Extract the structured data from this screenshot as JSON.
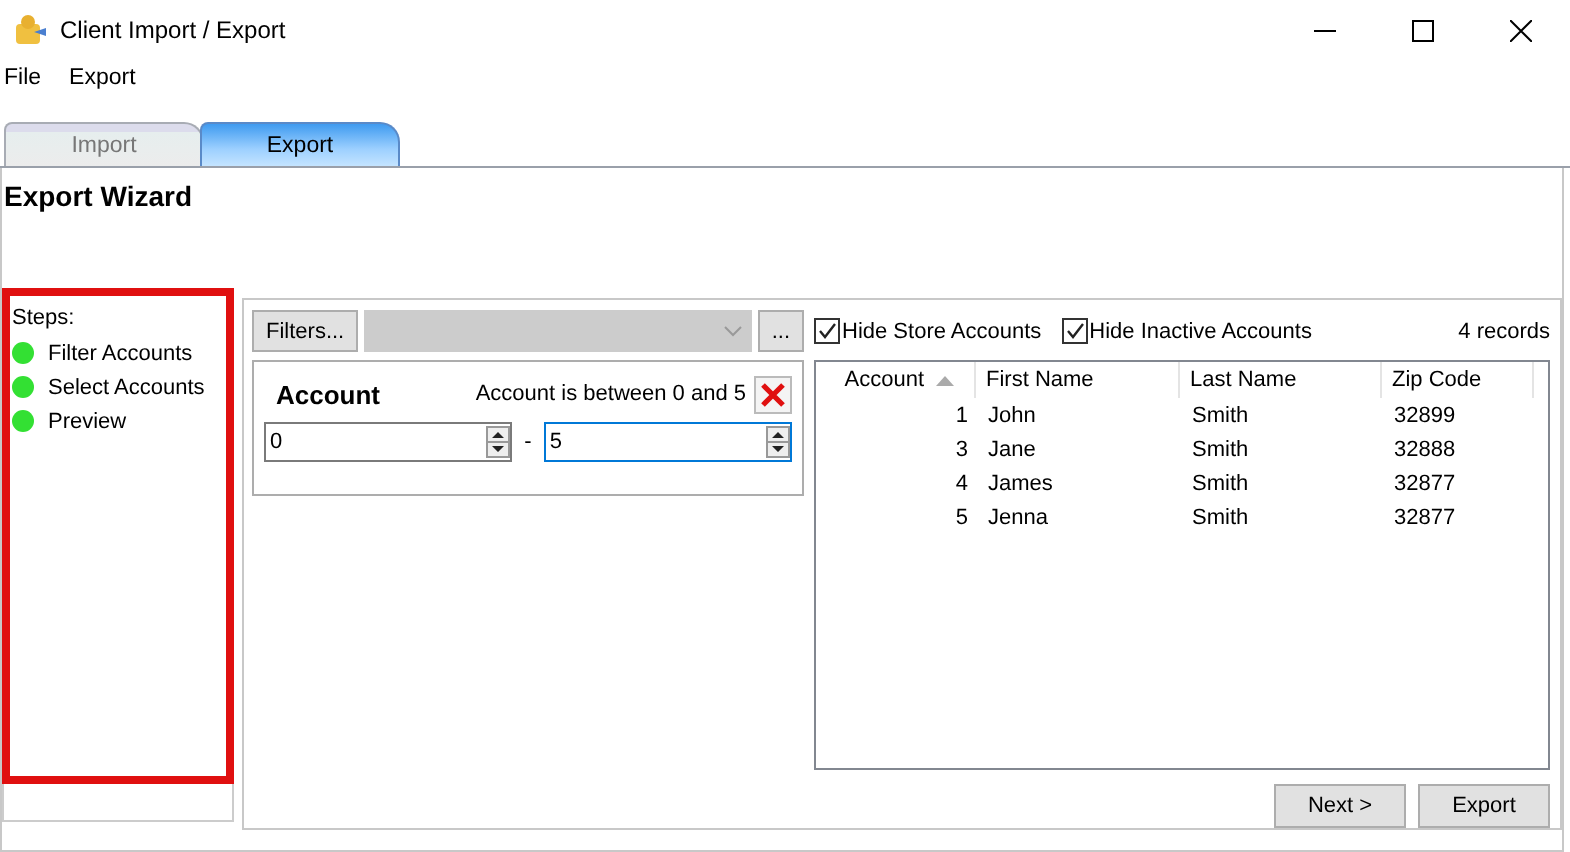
{
  "window": {
    "title": "Client Import / Export"
  },
  "menu": [
    "File",
    "Export"
  ],
  "tabs": [
    {
      "label": "Import",
      "selected": false
    },
    {
      "label": "Export",
      "selected": true
    }
  ],
  "wizard": {
    "title": "Export Wizard"
  },
  "steps": {
    "heading": "Steps:",
    "highlighted": true,
    "items": [
      {
        "label": "Filter Accounts",
        "color": "#33e033"
      },
      {
        "label": "Select Accounts",
        "color": "#33e033"
      },
      {
        "label": "Preview",
        "color": "#33e033"
      }
    ]
  },
  "filters": {
    "button": "Filters...",
    "combo_disabled": true,
    "more_button": "...",
    "card": {
      "field": "Account",
      "description": "Account is between 0 and 5",
      "separator": "-",
      "from": {
        "value": "0",
        "focused": false
      },
      "to": {
        "value": "5",
        "focused": true
      }
    }
  },
  "options": [
    {
      "label": "Hide Store Accounts",
      "checked": true
    },
    {
      "label": "Hide Inactive Accounts",
      "checked": true
    }
  ],
  "record_count": "4 records",
  "table": {
    "columns": [
      {
        "label": "Account",
        "sorted": true
      },
      {
        "label": "First Name",
        "sorted": false
      },
      {
        "label": "Last Name",
        "sorted": false
      },
      {
        "label": "Zip Code",
        "sorted": false
      }
    ],
    "rows": [
      [
        "1",
        "John",
        "Smith",
        "32899"
      ],
      [
        "3",
        "Jane",
        "Smith",
        "32888"
      ],
      [
        "4",
        "James",
        "Smith",
        "32877"
      ],
      [
        "5",
        "Jenna",
        "Smith",
        "32877"
      ]
    ]
  },
  "buttons": [
    "Next >",
    "Export"
  ]
}
